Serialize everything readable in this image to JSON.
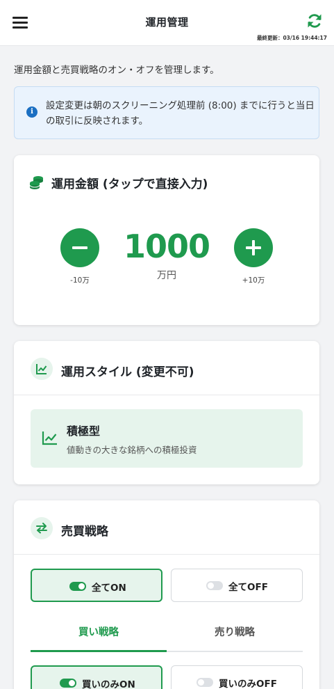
{
  "header": {
    "title": "運用管理",
    "last_updated": "最終更新：03/16 19:44:17",
    "menu_icon": "hamburger-menu-icon",
    "refresh_icon": "refresh-icon"
  },
  "intro": "運用金額と売買戦略のオン・オフを管理します。",
  "notice": {
    "icon": "info-icon",
    "text": "設定変更は朝のスクリーニング処理前 (8:00) までに行うと当日の取引に反映されます。"
  },
  "amount": {
    "title": "運用金額 (タップで直接入力)",
    "icon": "coins-icon",
    "value": "1000",
    "unit": "万円",
    "minus_label": "-10万",
    "plus_label": "+10万"
  },
  "style": {
    "title": "運用スタイル (変更不可)",
    "icon": "chart-line-icon",
    "name": "積極型",
    "description": "値動きの大きな銘柄への積極投資"
  },
  "trade": {
    "title": "売買戦略",
    "icon": "swap-arrows-icon",
    "all_on_label": "全てON",
    "all_off_label": "全てOFF",
    "all_on_active": true,
    "tabs": [
      "買い戦略",
      "売り戦略"
    ],
    "active_tab": 0,
    "buy_only_on_label": "買いのみON",
    "buy_only_off_label": "買いのみOFF"
  },
  "colors": {
    "accent": "#1f9a4e",
    "accent_light": "#e6f4ec",
    "info": "#1b6fc2",
    "info_bg": "#eaf3fd"
  }
}
